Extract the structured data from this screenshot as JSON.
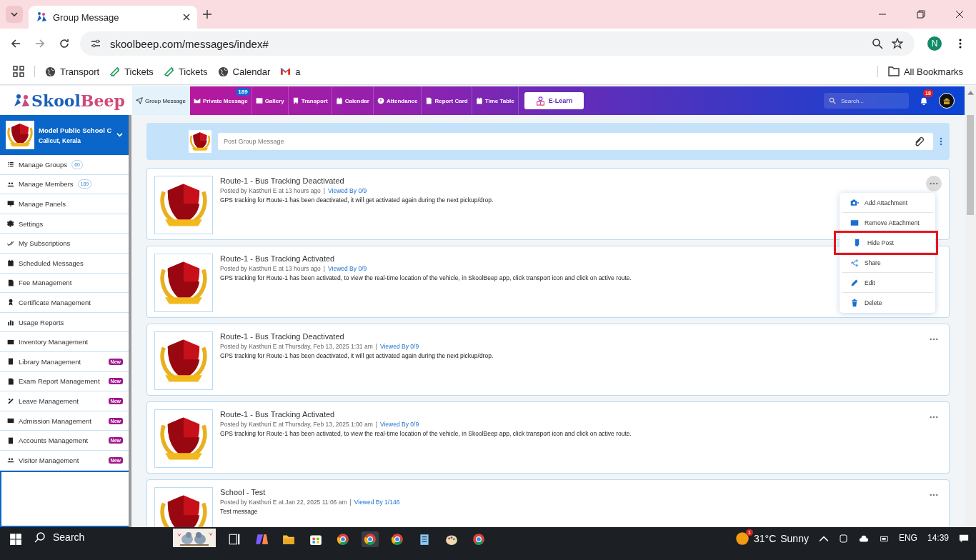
{
  "browser": {
    "tab_title": "Group Message",
    "url": "skoolbeep.com/messages/index#",
    "profile_initial": "N",
    "bookmarks": [
      {
        "label": "Transport",
        "kind": "globe"
      },
      {
        "label": "Tickets",
        "kind": "ticket"
      },
      {
        "label": "Tickets",
        "kind": "ticket"
      },
      {
        "label": "Calendar",
        "kind": "globe"
      },
      {
        "label": "a",
        "kind": "mail"
      }
    ],
    "all_bookmarks": "All Bookmarks"
  },
  "header": {
    "logo_first": "Skool",
    "logo_second": "Beep",
    "nav": [
      {
        "label": "Group Message",
        "selected": true
      },
      {
        "label": "Private Message",
        "selected": false,
        "badge": "189"
      },
      {
        "label": "Gallery",
        "selected": false
      },
      {
        "label": "Transport",
        "selected": false
      },
      {
        "label": "Calendar",
        "selected": false
      },
      {
        "label": "Attendance",
        "selected": false
      },
      {
        "label": "Report Card",
        "selected": false
      },
      {
        "label": "Time Table",
        "selected": false
      }
    ],
    "elearn": "E-Learn",
    "search_placeholder": "Search...",
    "notifications": "18"
  },
  "sidebar": {
    "school": "Model Public School C",
    "location": "Calicut, Kerala",
    "items": [
      {
        "label": "Manage Groups",
        "count": "60"
      },
      {
        "label": "Manage Members",
        "count": "189"
      },
      {
        "label": "Manage Panels"
      },
      {
        "label": "Settings"
      },
      {
        "label": "My Subscriptions"
      },
      {
        "label": "Scheduled Messages"
      },
      {
        "label": "Fee Management"
      },
      {
        "label": "Certificate Management"
      },
      {
        "label": "Usage Reports"
      },
      {
        "label": "Inventory Management"
      },
      {
        "label": "Library Management",
        "tag": "New"
      },
      {
        "label": "Exam Report Management",
        "tag": "New"
      },
      {
        "label": "Leave Management",
        "tag": "New"
      },
      {
        "label": "Admission Management",
        "tag": "New"
      },
      {
        "label": "Accounts Management",
        "tag": "New"
      },
      {
        "label": "Visitor Management",
        "tag": "New"
      }
    ]
  },
  "composer": {
    "placeholder": "Post Group Message"
  },
  "posts": [
    {
      "title": "Route-1 - Bus Tracking Deactivated",
      "meta": "Posted by Kasthuri E at 13 hours ago",
      "separator": "|",
      "viewed": "Viewed By 0/9",
      "body": "GPS tracking for Route-1 has been deactivated, it will get activated again during the next pickup/drop.",
      "menu_open": true
    },
    {
      "title": "Route-1 - Bus Tracking Activated",
      "meta": "Posted by Kasthuri E at 13 hours ago",
      "separator": "|",
      "viewed": "Viewed By 0/9",
      "body": "GPS tracking for Route-1 has been activated, to view the real-time location of the vehicle, in SkoolBeep app, click transport icon and click on active route.",
      "menu_open": false
    },
    {
      "title": "Route-1 - Bus Tracking Deactivated",
      "meta": "Posted by Kasthuri E at Thursday, Feb 13, 2025 1:31 am",
      "separator": "|",
      "viewed": "Viewed By 0/9",
      "body": "GPS tracking for Route-1 has been deactivated, it will get activated again during the next pickup/drop.",
      "menu_open": false
    },
    {
      "title": "Route-1 - Bus Tracking Activated",
      "meta": "Posted by Kasthuri E at Thursday, Feb 13, 2025 1:00 am",
      "separator": "|",
      "viewed": "Viewed By 0/9",
      "body": "GPS tracking for Route-1 has been activated, to view the real-time location of the vehicle, in SkoolBeep app, click transport icon and click on active route.",
      "menu_open": false
    },
    {
      "title": "School - Test",
      "meta": "Posted by Kasthuri E at Jan 22, 2025 11:06 am",
      "separator": "|",
      "viewed": "Viewed By 1/146",
      "body": "Test message",
      "menu_open": false
    }
  ],
  "menu": [
    {
      "label": "Add Attachment",
      "highlighted": false
    },
    {
      "label": "Remove Attachment",
      "highlighted": false
    },
    {
      "label": "Hide Post",
      "highlighted": true
    },
    {
      "label": "Share",
      "highlighted": false
    },
    {
      "label": "Edit",
      "highlighted": false
    },
    {
      "label": "Delete",
      "highlighted": false
    }
  ],
  "taskbar": {
    "search": "Search",
    "weather_alert": "1",
    "temperature": "31°C",
    "condition": "Sunny",
    "language": "ENG",
    "time": "14:39"
  }
}
